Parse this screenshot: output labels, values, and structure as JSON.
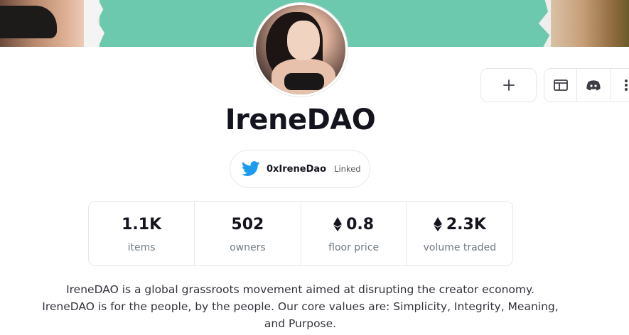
{
  "collection": {
    "name": "IreneDAO",
    "twitter": {
      "handle": "0xIreneDao",
      "status": "Linked"
    },
    "stats": [
      {
        "value": "1.1K",
        "label": "items",
        "currency_icon": false
      },
      {
        "value": "502",
        "label": "owners",
        "currency_icon": false
      },
      {
        "value": "0.8",
        "label": "floor price",
        "currency_icon": true
      },
      {
        "value": "2.3K",
        "label": "volume traded",
        "currency_icon": true
      }
    ],
    "description_lines": [
      "IreneDAO is a global grassroots movement aimed at disrupting the creator economy.",
      "IreneDAO is for the people, by the people. Our core values are: Simplicity, Integrity, Meaning,",
      "and Purpose."
    ]
  },
  "actions": {
    "add_icon": "plus-icon",
    "website_icon": "browser-window-icon",
    "discord_icon": "discord-icon",
    "more_icon": "more-vertical-icon"
  },
  "colors": {
    "banner": "#6cc9ae",
    "twitter": "#1d9bf0",
    "text": "#14141f",
    "muted": "#707a83",
    "border": "#e5e8eb"
  }
}
